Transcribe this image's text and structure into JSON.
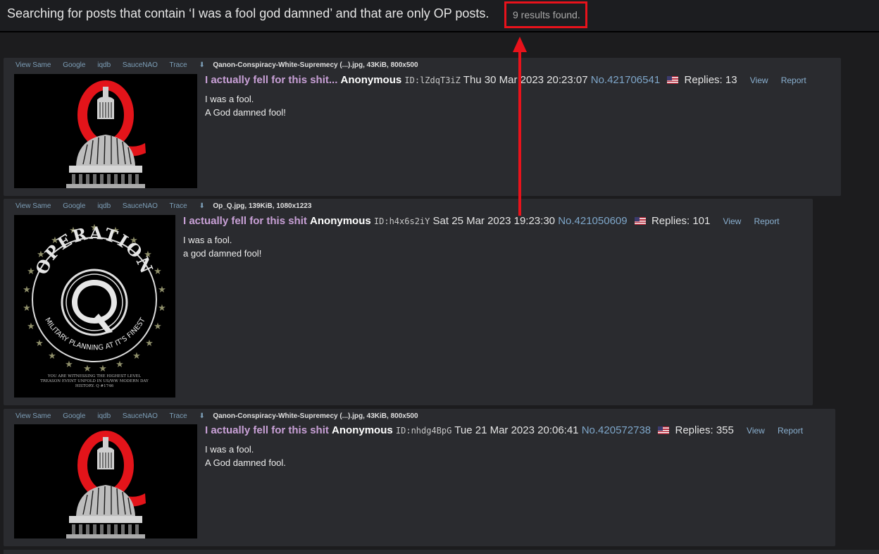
{
  "search": {
    "summary": "Searching for posts that contain ‘I was a fool god damned’ and that are only OP posts.",
    "results": "9 results found."
  },
  "file_links": {
    "view_same": "View Same",
    "google": "Google",
    "iqdb": "iqdb",
    "saucenao": "SauceNAO",
    "trace": "Trace"
  },
  "actions": {
    "view": "View",
    "report": "Report"
  },
  "posts": [
    {
      "file_info": "Qanon-Conspiracy-White-Supremecy (...).jpg, 43KiB, 800x500",
      "subject": "I actually fell for this shit...",
      "name": "Anonymous",
      "poster_id": "ID:lZdqT3iZ",
      "date": "Thu 30 Mar 2023 20:23:07",
      "number": "No.421706541",
      "replies": "Replies: 13",
      "body_line1": "I was a fool.",
      "body_line2": "A God damned fool!",
      "thumb_icon": "q-capitol-image"
    },
    {
      "file_info": "Op_Q.jpg, 139KiB, 1080x1223",
      "subject": "I actually fell for this shit",
      "name": "Anonymous",
      "poster_id": "ID:h4x6s2iY",
      "date": "Sat 25 Mar 2023 19:23:30",
      "number": "No.421050609",
      "replies": "Replies: 101",
      "body_line1": "I was a fool.",
      "body_line2": "a god damned fool!",
      "thumb_icon": "operation-q-image",
      "thumb_text_top": "OPERATION",
      "thumb_text_bottom": "MILITARY PLANNING AT IT'S FINEST",
      "thumb_caption1": "YOU ARE WITNESSING THE HIGHEST LEVEL",
      "thumb_caption2": "TREASON EVENT UNFOLD IN US/WW MODERN DAY",
      "thumb_caption3": "HISTORY. Q #1746"
    },
    {
      "file_info": "Qanon-Conspiracy-White-Supremecy (...).jpg, 43KiB, 800x500",
      "subject": "I actually fell for this shit",
      "name": "Anonymous",
      "poster_id": "ID:nhdg4BpG",
      "date": "Tue 21 Mar 2023 20:06:41",
      "number": "No.420572738",
      "replies": "Replies: 355",
      "body_line1": "I was a fool.",
      "body_line2": "A God damned fool.",
      "thumb_icon": "q-capitol-image"
    }
  ],
  "colors": {
    "highlight_box": "#e8121b",
    "subject": "#c8a0d6",
    "link": "#7d9fb8"
  }
}
